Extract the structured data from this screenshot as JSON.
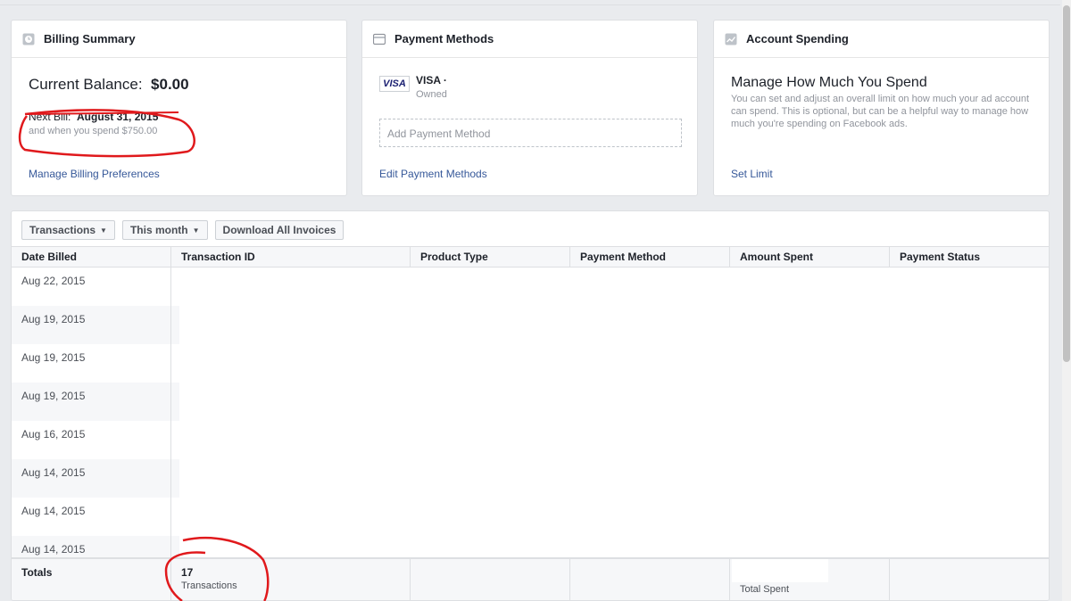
{
  "billing_summary": {
    "title": "Billing Summary",
    "icon": "clock-icon",
    "balance_label": "Current Balance:",
    "balance_value": "$0.00",
    "next_bill_label": "Next Bill:",
    "next_bill_date": "August 31, 2015",
    "spend_threshold": "and when you spend $750.00",
    "manage_link": "Manage Billing Preferences"
  },
  "payment_methods": {
    "title": "Payment Methods",
    "icon": "card-icon",
    "card_brand_badge": "VISA",
    "card_name": "VISA ·",
    "card_status": "Owned",
    "add_label": "Add Payment Method",
    "edit_link": "Edit Payment Methods"
  },
  "account_spending": {
    "title": "Account Spending",
    "icon": "chart-icon",
    "heading": "Manage How Much You Spend",
    "description": "You can set and adjust an overall limit on how much your ad account can spend. This is optional, but can be a helpful way to manage how much you're spending on Facebook ads.",
    "set_limit_link": "Set Limit"
  },
  "toolbar": {
    "transactions_label": "Transactions",
    "period_label": "This month",
    "download_label": "Download All Invoices"
  },
  "table": {
    "columns": [
      "Date Billed",
      "Transaction ID",
      "Product Type",
      "Payment Method",
      "Amount Spent",
      "Payment Status"
    ],
    "rows": [
      "Aug 22, 2015",
      "Aug 19, 2015",
      "Aug 19, 2015",
      "Aug 19, 2015",
      "Aug 16, 2015",
      "Aug 14, 2015",
      "Aug 14, 2015",
      "Aug 14, 2015"
    ],
    "totals_label": "Totals",
    "totals_count": "17",
    "totals_count_label": "Transactions",
    "totals_spent_label": "Total Spent"
  },
  "colors": {
    "link": "#365899",
    "annotation": "#e0191c"
  }
}
